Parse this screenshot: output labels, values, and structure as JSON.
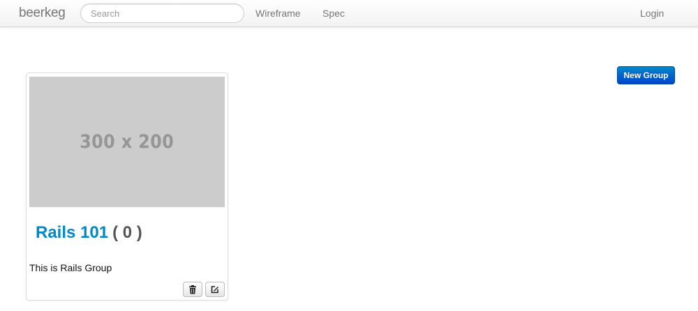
{
  "navbar": {
    "brand": "beerkeg",
    "search_placeholder": "Search",
    "links": [
      "Wireframe",
      "Spec"
    ],
    "login": "Login"
  },
  "actions": {
    "new_group": "New Group"
  },
  "groups": [
    {
      "image_placeholder": "300 x 200",
      "name": "Rails 101",
      "count": "( 0 )",
      "description": "This is Rails Group",
      "buttons": {
        "delete_icon": "trash-icon",
        "edit_icon": "edit-icon"
      }
    }
  ],
  "colors": {
    "link": "#0088cc",
    "primary_button": "#0055cc",
    "placeholder_bg": "#cccccc"
  }
}
